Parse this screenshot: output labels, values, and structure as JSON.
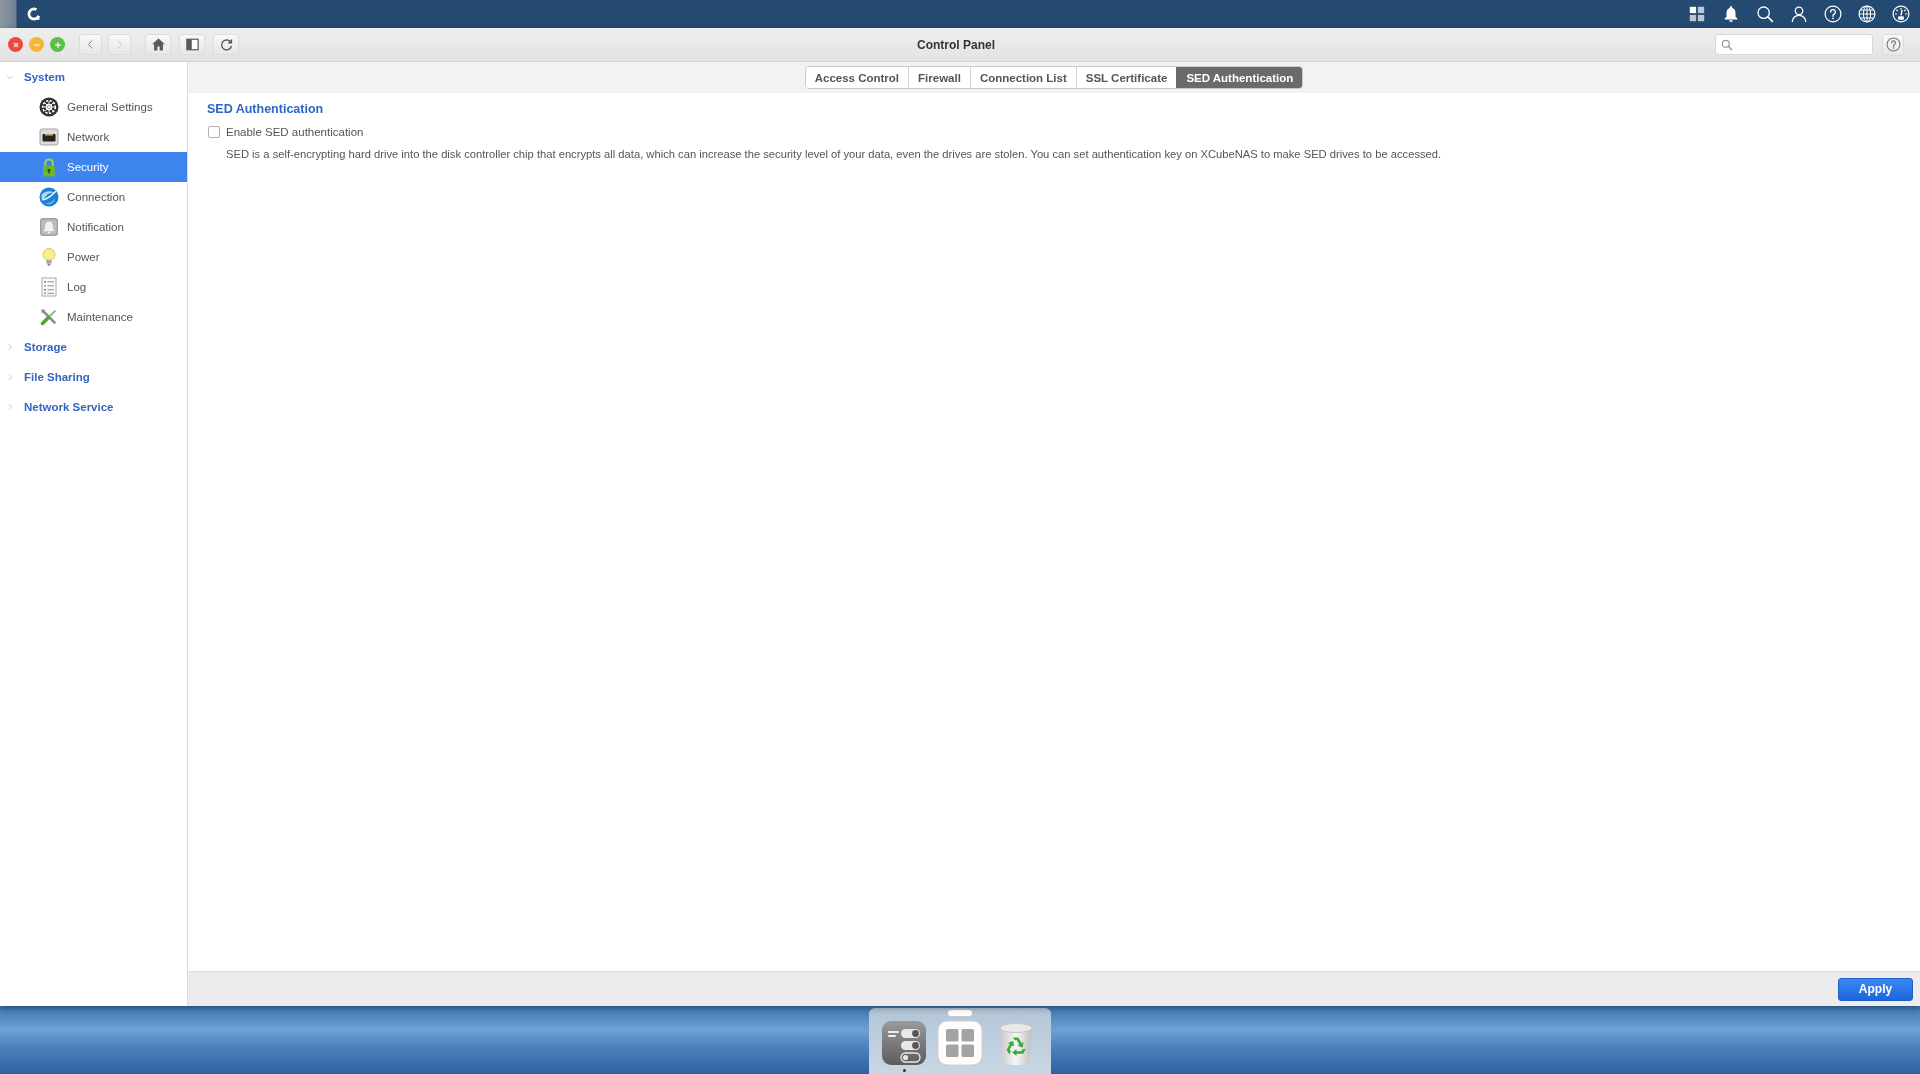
{
  "window": {
    "title": "Control Panel",
    "navigation": {
      "back": {
        "disabled": false
      },
      "forward": {
        "disabled": true
      }
    }
  },
  "sidebar": {
    "groups": [
      {
        "label": "System",
        "expanded": true,
        "children": [
          {
            "label": "General Settings",
            "selected": false
          },
          {
            "label": "Network",
            "selected": false
          },
          {
            "label": "Security",
            "selected": true
          },
          {
            "label": "Connection",
            "selected": false
          },
          {
            "label": "Notification",
            "selected": false
          },
          {
            "label": "Power",
            "selected": false
          },
          {
            "label": "Log",
            "selected": false
          },
          {
            "label": "Maintenance",
            "selected": false
          }
        ]
      },
      {
        "label": "Storage",
        "expanded": false
      },
      {
        "label": "File Sharing",
        "expanded": false
      },
      {
        "label": "Network Service",
        "expanded": false
      }
    ]
  },
  "tabs": [
    {
      "label": "Access Control",
      "selected": false
    },
    {
      "label": "Firewall",
      "selected": false
    },
    {
      "label": "Connection List",
      "selected": false
    },
    {
      "label": "SSL Certificate",
      "selected": false
    },
    {
      "label": "SED Authentication",
      "selected": true
    }
  ],
  "section": {
    "title": "SED Authentication",
    "checkbox": {
      "label": "Enable SED authentication",
      "checked": false
    },
    "description": "SED is a self-encrypting hard drive into the disk controller chip that encrypts all data, which can increase the security level of your data, even the drives are stolen. You can set authentication key on XCubeNAS to make SED drives to be accessed."
  },
  "footer": {
    "buttons": [
      "Apply"
    ]
  },
  "dock": {
    "items": [
      {
        "kind": "settings",
        "running": true
      },
      {
        "kind": "apps",
        "running": false
      },
      {
        "kind": "trash",
        "running": false
      }
    ]
  }
}
